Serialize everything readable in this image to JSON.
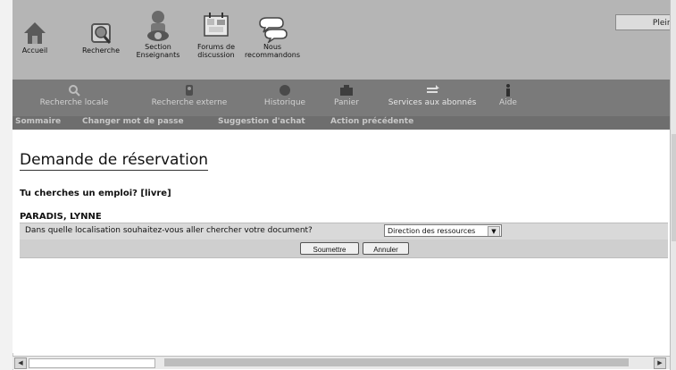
{
  "top_header": {
    "plein_text": "Plein é",
    "nav": [
      {
        "label": "Accueil"
      },
      {
        "label": "Recherche"
      },
      {
        "label": "Section\nEnseignants"
      },
      {
        "label": "Forums de\ndiscussion"
      },
      {
        "label": "Nous\nrecommandons"
      }
    ]
  },
  "secondary_nav": {
    "items": [
      {
        "label": "Recherche locale"
      },
      {
        "label": "Recherche externe"
      },
      {
        "label": "Historique"
      },
      {
        "label": "Panier"
      },
      {
        "label": "Services aux abonnés"
      },
      {
        "label": "Aide"
      }
    ]
  },
  "tertiary_nav": {
    "items": [
      {
        "label": "Sommaire"
      },
      {
        "label": "Changer mot de passe"
      },
      {
        "label": "Suggestion d'achat"
      },
      {
        "label": "Action précédente"
      }
    ]
  },
  "content": {
    "title": "Demande de réservation",
    "book_title": "Tu cherches un emploi? [livre]",
    "author": "PARADIS, LYNNE",
    "question": "Dans quelle localisation souhaitez-vous aller chercher votre document?",
    "select_value": "Direction des ressources",
    "submit_label": "Soumettre",
    "cancel_label": "Annuler"
  }
}
